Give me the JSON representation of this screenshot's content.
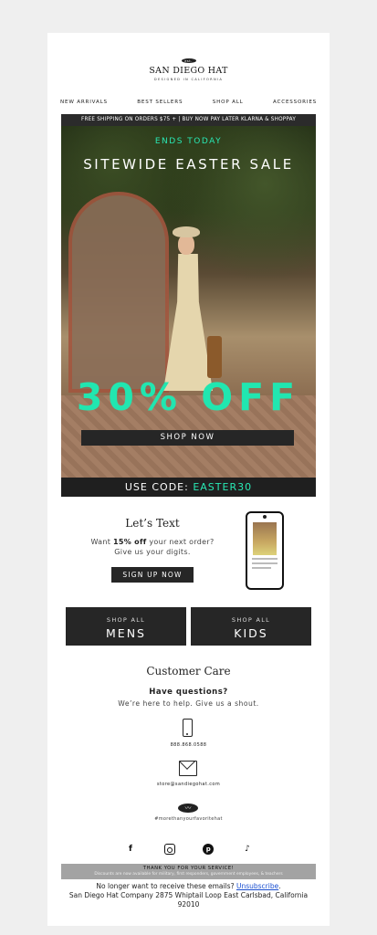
{
  "brand": {
    "est": "est. 1980",
    "name": "SAN DIEGO HAT",
    "tagline": "DESIGNED IN CALIFORNIA"
  },
  "nav": [
    "NEW ARRIVALS",
    "BEST SELLERS",
    "SHOP ALL",
    "ACCESSORIES"
  ],
  "promo_bar": "FREE SHIPPING ON ORDERS $75 + | BUY NOW PAY LATER KLARNA & SHOPPAY",
  "hero": {
    "kicker": "ENDS TODAY",
    "headline": "SITEWIDE EASTER SALE",
    "discount": "30% OFF",
    "cta": "SHOP NOW"
  },
  "code": {
    "prefix": "USE CODE: ",
    "value": "EASTER30"
  },
  "text_signup": {
    "title": "Let’s Text",
    "desc_before": "Want ",
    "desc_bold": "15% off",
    "desc_after": " your next order?",
    "desc_line2": "Give us your digits.",
    "cta": "SIGN UP NOW"
  },
  "categories": [
    {
      "small": "SHOP ALL",
      "big": "MENS"
    },
    {
      "small": "SHOP ALL",
      "big": "KIDS"
    }
  ],
  "care": {
    "title": "Customer Care",
    "question": "Have questions?",
    "sub": "We’re here to help. Give us a shout.",
    "phone": "888.868.0588",
    "email": "store@sandiegohat.com",
    "hashtag": "#morethanyourfavoritehat"
  },
  "social": [
    "facebook-icon",
    "instagram-icon",
    "pinterest-icon",
    "tiktok-icon"
  ],
  "thanks": {
    "title": "THANK YOU FOR YOUR SERVICE!",
    "sub": "Discounts are now available for military, first responders, government employees, & teachers"
  },
  "footer": {
    "unsub_prefix": "No longer want to receive these emails? ",
    "unsub_link": "Unsubscribe",
    "unsub_suffix": ".",
    "address": "San Diego Hat Company 2875 Whiptail Loop East Carlsbad, California 92010"
  }
}
